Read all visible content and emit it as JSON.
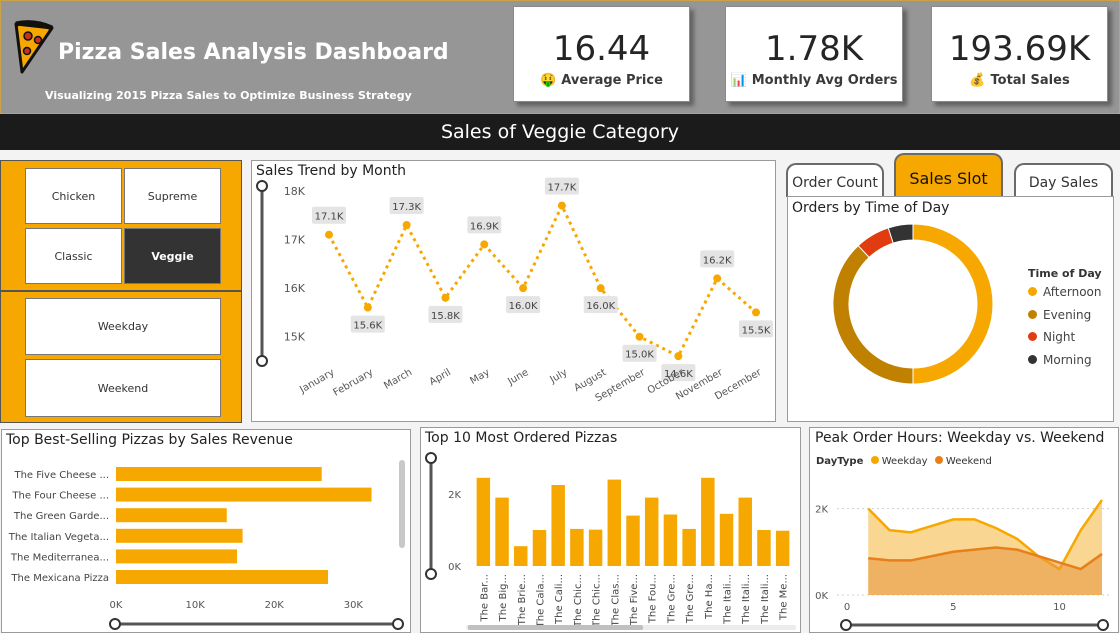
{
  "header": {
    "title": "Pizza Sales Analysis Dashboard",
    "subtitle": "Visualizing 2015 Pizza Sales to Optimize Business Strategy",
    "kpis": [
      {
        "value": "16.44",
        "label": "Average Price",
        "icon": "money-face-icon"
      },
      {
        "value": "1.78K",
        "label": "Monthly Avg Orders",
        "icon": "bar-chart-icon"
      },
      {
        "value": "193.69K",
        "label": "Total Sales",
        "icon": "money-bag-icon"
      }
    ],
    "banner": "Sales of Veggie Category"
  },
  "category_slicer": {
    "options": [
      "Chicken",
      "Supreme",
      "Classic",
      "Veggie"
    ],
    "selected": "Veggie"
  },
  "daytype_slicer": {
    "options": [
      "Weekday",
      "Weekend"
    ]
  },
  "tabs": [
    {
      "label": "Order Count",
      "active": false
    },
    {
      "label": "Sales Slot",
      "active": true
    },
    {
      "label": "Day Sales",
      "active": false
    }
  ],
  "colors": {
    "accent": "#f7a800",
    "evening": "#c08000",
    "night": "#e03c10",
    "morning": "#333333",
    "weekend": "#e8801a"
  },
  "chart_data": [
    {
      "id": "sales_trend",
      "type": "line",
      "title": "Sales Trend by Month",
      "categories": [
        "January",
        "February",
        "March",
        "April",
        "May",
        "June",
        "July",
        "August",
        "September",
        "October",
        "November",
        "December"
      ],
      "values": [
        17100,
        15600,
        17300,
        15800,
        16900,
        16000,
        17700,
        16000,
        15000,
        14600,
        16200,
        15500
      ],
      "data_labels": [
        "17.1K",
        "15.6K",
        "17.3K",
        "15.8K",
        "16.9K",
        "16.0K",
        "17.7K",
        "16.0K",
        "15.0K",
        "14.6K",
        "16.2K",
        "15.5K"
      ],
      "y_ticks": [
        15000,
        16000,
        17000,
        18000
      ],
      "y_tick_labels": [
        "15K",
        "16K",
        "17K",
        "18K"
      ],
      "ylim": [
        14500,
        18000
      ]
    },
    {
      "id": "time_of_day",
      "type": "pie",
      "title": "Orders by Time of Day",
      "legend_title": "Time of Day",
      "labels": [
        "Afternoon",
        "Evening",
        "Night",
        "Morning"
      ],
      "values": [
        50,
        38,
        7,
        5
      ],
      "colors": [
        "#f7a800",
        "#c08000",
        "#e03c10",
        "#333333"
      ]
    },
    {
      "id": "best_selling",
      "type": "bar",
      "title": "Top Best-Selling Pizzas by Sales Revenue",
      "categories": [
        "The Five Cheese ...",
        "The Four Cheese ...",
        "The Green Garde...",
        "The Italian Vegeta...",
        "The Mediterranea...",
        "The Mexicana Pizza"
      ],
      "values": [
        26000,
        32300,
        14000,
        16000,
        15300,
        26800
      ],
      "x_ticks": [
        0,
        10000,
        20000,
        30000
      ],
      "x_tick_labels": [
        "0K",
        "10K",
        "20K",
        "30K"
      ],
      "xlim": [
        0,
        34000
      ]
    },
    {
      "id": "most_ordered",
      "type": "bar",
      "title": "Top 10 Most Ordered Pizzas",
      "categories": [
        "The Bar...",
        "The Big...",
        "The Brie...",
        "The Cala...",
        "The Cali...",
        "The Chic...",
        "The Chic...",
        "The Clas...",
        "The Five...",
        "The Fou...",
        "The Gre...",
        "The Gre...",
        "The Ha...",
        "The Itali...",
        "The Itali...",
        "The Itali...",
        "The Me..."
      ],
      "values": [
        2450,
        1900,
        550,
        1000,
        2250,
        1030,
        1010,
        2400,
        1400,
        1900,
        1430,
        1030,
        2450,
        1450,
        1900,
        1000,
        980
      ],
      "y_ticks": [
        0,
        2000
      ],
      "y_tick_labels": [
        "0K",
        "2K"
      ],
      "ylim": [
        0,
        3000
      ]
    },
    {
      "id": "peak_hours",
      "type": "area",
      "title": "Peak Order Hours: Weekday vs. Weekend",
      "legend_title": "DayType",
      "x": [
        1,
        2,
        3,
        4,
        5,
        6,
        7,
        8,
        9,
        10,
        11,
        12
      ],
      "series": [
        {
          "name": "Weekday",
          "values": [
            2000,
            1500,
            1450,
            1600,
            1750,
            1750,
            1550,
            1300,
            900,
            600,
            1500,
            2200
          ]
        },
        {
          "name": "Weekend",
          "values": [
            850,
            800,
            800,
            900,
            1000,
            1050,
            1100,
            1050,
            900,
            750,
            600,
            950
          ]
        }
      ],
      "x_ticks": [
        0,
        5,
        10
      ],
      "x_tick_labels": [
        "0",
        "5",
        "10"
      ],
      "y_ticks": [
        0,
        2000
      ],
      "y_tick_labels": [
        "0K",
        "2K"
      ],
      "xlim": [
        0,
        12
      ],
      "ylim": [
        0,
        2800
      ]
    }
  ]
}
